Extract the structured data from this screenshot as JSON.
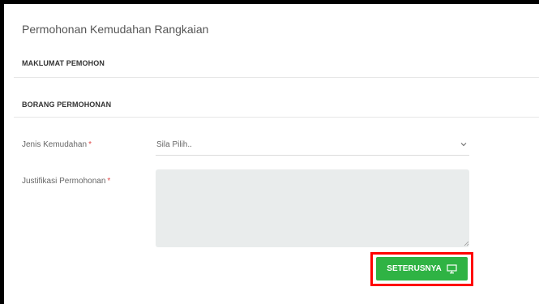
{
  "page": {
    "title": "Permohonan Kemudahan Rangkaian"
  },
  "sections": [
    {
      "title": "MAKLUMAT PEMOHON"
    },
    {
      "title": "BORANG PERMOHONAN"
    }
  ],
  "form": {
    "jenis_kemudahan": {
      "label": "Jenis Kemudahan",
      "required_mark": "*",
      "value": "Sila Pilih.."
    },
    "justifikasi": {
      "label": "Justifikasi Permohonan",
      "required_mark": "*",
      "value": ""
    }
  },
  "actions": {
    "next_label": "SETERUSNYA",
    "next_icon": "monitor-icon"
  },
  "colors": {
    "primary_button": "#2fb344",
    "highlight": "#ff0000",
    "required": "#e04848"
  }
}
